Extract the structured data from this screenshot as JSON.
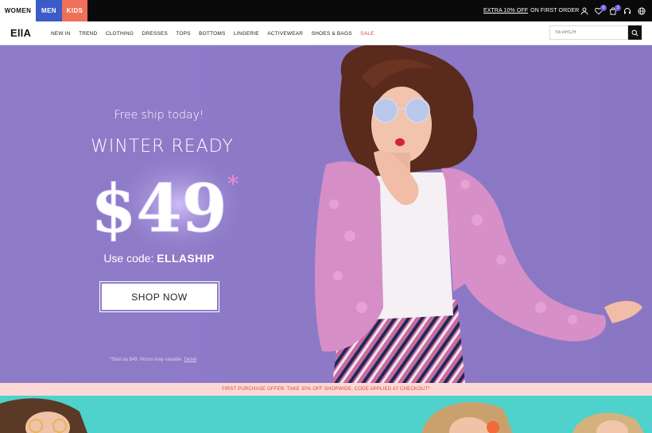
{
  "topbar": {
    "segments": [
      "WOMEN",
      "MEN",
      "KIDS"
    ],
    "promo_link": "EXTRA 10% OFF",
    "promo_text": "ON FIRST ORDER",
    "wishlist_count": "0",
    "cart_count": "3"
  },
  "nav": {
    "logo": "EllA",
    "items": [
      "NEW IN",
      "TREND",
      "CLOTHING",
      "DRESSES",
      "TOPS",
      "BOTTOMS",
      "LINGERIE",
      "ACTIVEWEAR",
      "SHOES & BAGS",
      "SALE"
    ],
    "search_placeholder": "SEARCH"
  },
  "hero": {
    "free_ship": "Free ship today!",
    "headline": "WINTER READY",
    "price": "$49",
    "asterisk": "*",
    "code_prefix": "Use code: ",
    "code": "ELLASHIP",
    "button": "SHOP NOW",
    "fine_print": "*Start as $49. Prices may variable. ",
    "fine_link": "Detail"
  },
  "offer_strip": "FIRST PURCHASE OFFER: TAKE 30% OFF SHOPWIDE. CODE APPLIED AT CHECKOUT*",
  "colors": {
    "hero_bg": "#8c79c6",
    "men": "#3b5bc9",
    "kids": "#ef6f58",
    "sale": "#e0473b",
    "offer_bg": "#fcd9d7",
    "bottom_bg": "#4fd2cc"
  }
}
